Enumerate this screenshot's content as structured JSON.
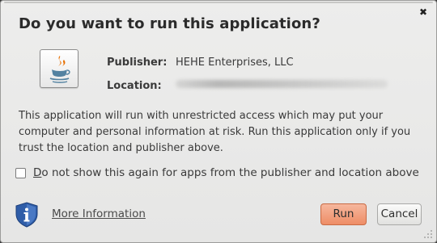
{
  "dialog": {
    "title": "Do you want to run this application?",
    "close_icon": "✖"
  },
  "app_icon": "java-icon",
  "publisher": {
    "label": "Publisher:",
    "value": "HEHE Enterprises, LLC"
  },
  "location": {
    "label": "Location:"
  },
  "warning_text": "This application will run with unrestricted access which may put your computer and personal information at risk. Run this application only if you trust the location and publisher above.",
  "checkbox": {
    "mnemonic": "D",
    "label_rest": "o not show this again for apps from the publisher and location above",
    "checked": false
  },
  "more_info": "More Information",
  "buttons": {
    "run": "Run",
    "cancel": "Cancel"
  },
  "colors": {
    "run_button": "#ee8d66",
    "dialog_bg": "#e9e9e8",
    "shield": "#2f5da8"
  }
}
